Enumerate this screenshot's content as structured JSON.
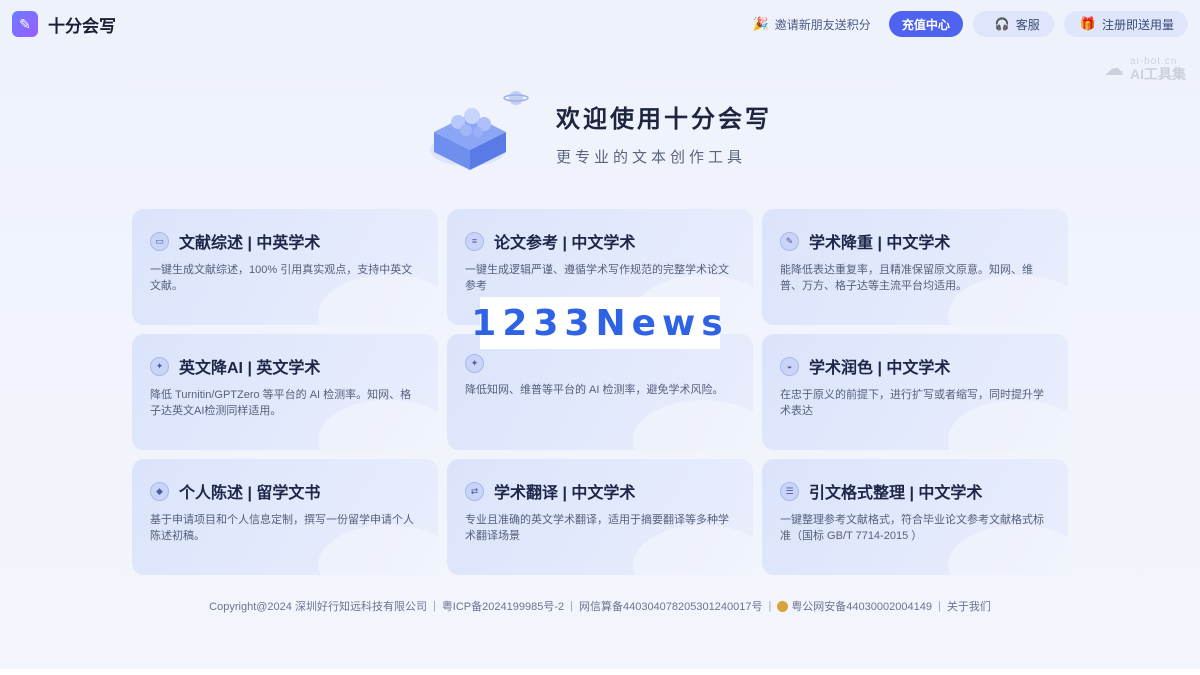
{
  "header": {
    "app_name": "十分会写",
    "invite_label": "邀请新朋友送积分",
    "recharge_label": "充值中心",
    "service_label": "客服",
    "register_label": "注册即送用量"
  },
  "watermark": {
    "line1": "ai-bot.cn",
    "line2": "AI工具集"
  },
  "hero": {
    "title": "欢迎使用十分会写",
    "subtitle": "更专业的文本创作工具"
  },
  "cards": [
    {
      "title": "文献综述 | 中英学术",
      "desc": "一键生成文献综述，100% 引用真实观点，支持中英文文献。",
      "icon": "document-icon"
    },
    {
      "title": "论文参考 | 中文学术",
      "desc": "一键生成逻辑严谨、遵循学术写作规范的完整学术论文参考",
      "icon": "paper-icon"
    },
    {
      "title": "学术降重 | 中文学术",
      "desc": "能降低表达重复率，且精准保留原文原意。知网、维普、万方、格子达等主流平台均适用。",
      "icon": "edit-icon"
    },
    {
      "title": "英文降AI | 英文学术",
      "desc": "降低 Turnitin/GPTZero 等平台的 AI 检测率。知网、格子达英文AI检测同样适用。",
      "icon": "ai-icon"
    },
    {
      "title": "",
      "desc": "降低知网、维普等平台的 AI 检测率，避免学术风险。",
      "icon": "ai-icon"
    },
    {
      "title": "学术润色 | 中文学术",
      "desc": "在忠于原义的前提下，进行扩写或者缩写，同时提升学术表达",
      "icon": "polish-icon"
    },
    {
      "title": "个人陈述 | 留学文书",
      "desc": "基于申请项目和个人信息定制，撰写一份留学申请个人陈述初稿。",
      "icon": "graduation-icon"
    },
    {
      "title": "学术翻译 | 中文学术",
      "desc": "专业且准确的英文学术翻译，适用于摘要翻译等多种学术翻译场景",
      "icon": "translate-icon"
    },
    {
      "title": "引文格式整理 | 中文学术",
      "desc": "一键整理参考文献格式，符合毕业论文参考文献格式标准（国标 GB/T 7714-2015 ）",
      "icon": "list-icon"
    }
  ],
  "overlay_text": "1233News",
  "footer": {
    "copyright": "Copyright@2024 深圳好行知远科技有限公司",
    "icp": "粤ICP备2024199985号-2",
    "algorithm": "网信算备440304078205301240017号",
    "police": "粤公网安备44030002004149",
    "about": "关于我们"
  }
}
